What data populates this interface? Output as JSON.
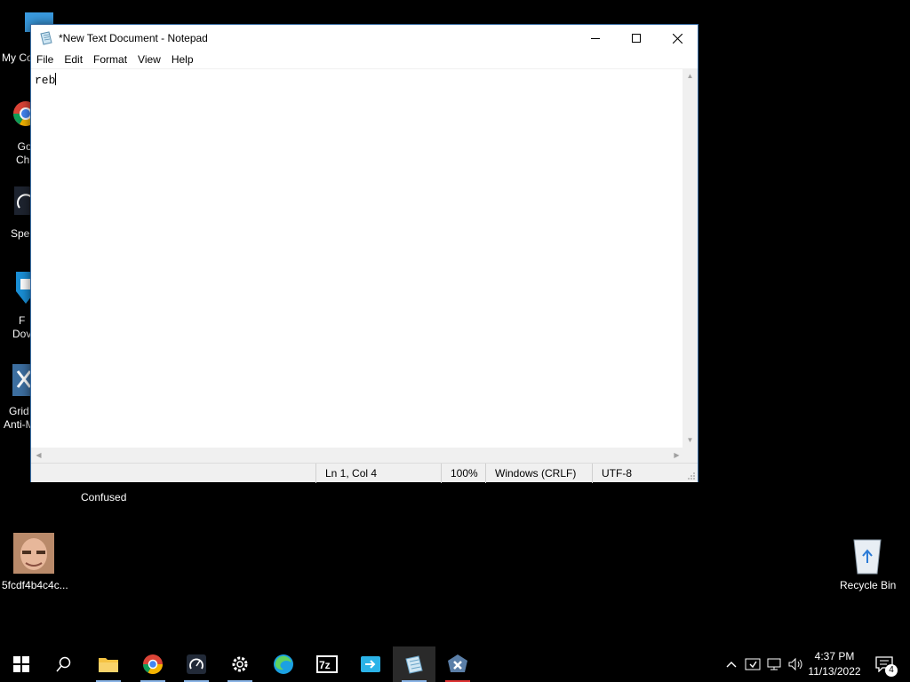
{
  "desktop": {
    "icons": [
      {
        "label": "My Co"
      },
      {
        "label": "Go\nChr"
      },
      {
        "label": "Spe"
      },
      {
        "label": "F\nDov"
      },
      {
        "label": "Grid\nAnti-M"
      },
      {
        "label": "Confused"
      },
      {
        "label": "5fcdf4b4c4c..."
      },
      {
        "label": "Recycle Bin"
      }
    ]
  },
  "window": {
    "title": "*New Text Document - Notepad",
    "menu": [
      "File",
      "Edit",
      "Format",
      "View",
      "Help"
    ],
    "content": "reb",
    "status": {
      "position": "Ln 1, Col 4",
      "zoom": "100%",
      "line_ending": "Windows (CRLF)",
      "encoding": "UTF-8"
    }
  },
  "taskbar": {
    "apps": [
      "start-icon",
      "search-icon",
      "file-explorer-icon",
      "chrome-icon",
      "speedometer-icon",
      "settings-icon",
      "edge-icon",
      "7zip-icon",
      "file-transfer-icon",
      "notepad-icon",
      "gridinsoft-icon"
    ],
    "clock": {
      "time": "4:37 PM",
      "date": "11/13/2022"
    },
    "notification_count": "4"
  },
  "colors": {
    "accent": "#0078d7",
    "window_border": "#3a6ea5",
    "desktop": "#000000"
  }
}
